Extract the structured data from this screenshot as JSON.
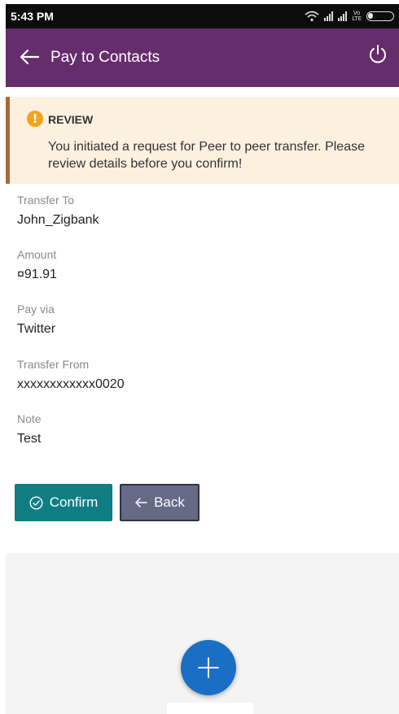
{
  "status_bar": {
    "time": "5:43 PM",
    "icons": [
      "wifi-icon",
      "signal-icon",
      "signal-icon",
      "volte-icon",
      "battery-icon"
    ],
    "volte_text": "VoLTE"
  },
  "header": {
    "title": "Pay to Contacts",
    "background": "#652d6b"
  },
  "review": {
    "title": "REVIEW",
    "message": "You initiated a request for Peer to peer transfer. Please review details before you confirm!"
  },
  "details": [
    {
      "label": "Transfer To",
      "value": "John_Zigbank"
    },
    {
      "label": "Amount",
      "value": "¤91.91"
    },
    {
      "label": "Pay via",
      "value": "Twitter"
    },
    {
      "label": "Transfer From",
      "value": "xxxxxxxxxxxx0020"
    },
    {
      "label": "Note",
      "value": "Test"
    }
  ],
  "actions": {
    "confirm_label": "Confirm",
    "back_label": "Back"
  },
  "colors": {
    "accent": "#0e7e83",
    "secondary": "#656a85",
    "fab": "#1a6fc4"
  }
}
